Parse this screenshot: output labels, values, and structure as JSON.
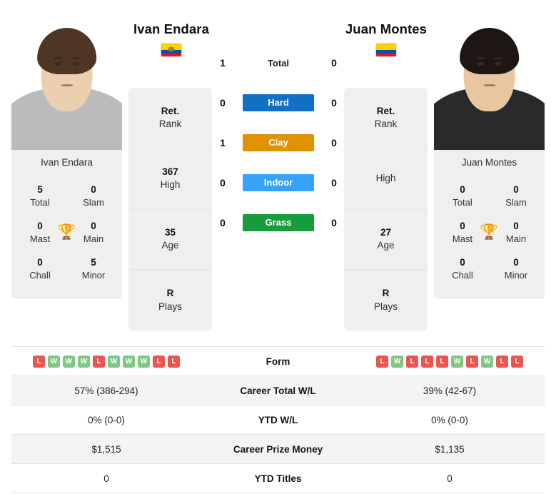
{
  "players": {
    "left": {
      "name": "Ivan Endara",
      "flag": "ecuador-flag",
      "photo_name": "Ivan Endara",
      "titles": {
        "total_value": "5",
        "total_label": "Total",
        "slam_value": "0",
        "slam_label": "Slam",
        "mast_value": "0",
        "mast_label": "Mast",
        "main_value": "0",
        "main_label": "Main",
        "chall_value": "0",
        "chall_label": "Chall",
        "minor_value": "5",
        "minor_label": "Minor",
        "trophy_icon": "trophy-icon"
      },
      "ranks": [
        {
          "value": "Ret.",
          "label": "Rank"
        },
        {
          "value": "367",
          "label": "High"
        },
        {
          "value": "35",
          "label": "Age"
        },
        {
          "value": "R",
          "label": "Plays"
        }
      ],
      "surface_wins": {
        "total": "1",
        "hard": "0",
        "clay": "1",
        "indoor": "0",
        "grass": "0"
      },
      "form": [
        "L",
        "W",
        "W",
        "W",
        "L",
        "W",
        "W",
        "W",
        "L",
        "L"
      ],
      "career_total_wl": "57% (386-294)",
      "ytd_wl": "0% (0-0)",
      "career_prize_money": "$1,515",
      "ytd_titles": "0"
    },
    "right": {
      "name": "Juan Montes",
      "flag": "colombia-flag",
      "photo_name": "Juan Montes",
      "titles": {
        "total_value": "0",
        "total_label": "Total",
        "slam_value": "0",
        "slam_label": "Slam",
        "mast_value": "0",
        "mast_label": "Mast",
        "main_value": "0",
        "main_label": "Main",
        "chall_value": "0",
        "chall_label": "Chall",
        "minor_value": "0",
        "minor_label": "Minor",
        "trophy_icon": "trophy-icon"
      },
      "ranks": [
        {
          "value": "Ret.",
          "label": "Rank"
        },
        {
          "value": "",
          "label": "High"
        },
        {
          "value": "27",
          "label": "Age"
        },
        {
          "value": "R",
          "label": "Plays"
        }
      ],
      "surface_wins": {
        "total": "0",
        "hard": "0",
        "clay": "0",
        "indoor": "0",
        "grass": "0"
      },
      "form": [
        "L",
        "W",
        "L",
        "L",
        "L",
        "W",
        "L",
        "W",
        "L",
        "L"
      ],
      "career_total_wl": "39% (42-67)",
      "ytd_wl": "0% (0-0)",
      "career_prize_money": "$1,135",
      "ytd_titles": "0"
    }
  },
  "surfaces": {
    "total_label": "Total",
    "hard_label": "Hard",
    "clay_label": "Clay",
    "indoor_label": "Indoor",
    "grass_label": "Grass"
  },
  "table_labels": {
    "form": "Form",
    "career_total_wl": "Career Total W/L",
    "ytd_wl": "YTD W/L",
    "career_prize_money": "Career Prize Money",
    "ytd_titles": "YTD Titles"
  },
  "colors": {
    "hard": "#1170c4",
    "clay": "#e09200",
    "indoor": "#36a3f7",
    "grass": "#179b3d",
    "win_badge": "#81c784",
    "loss_badge": "#ef5350",
    "trophy": "#3b6fb0",
    "card_bg": "#efefef",
    "row_alt_bg": "#f4f4f4"
  }
}
